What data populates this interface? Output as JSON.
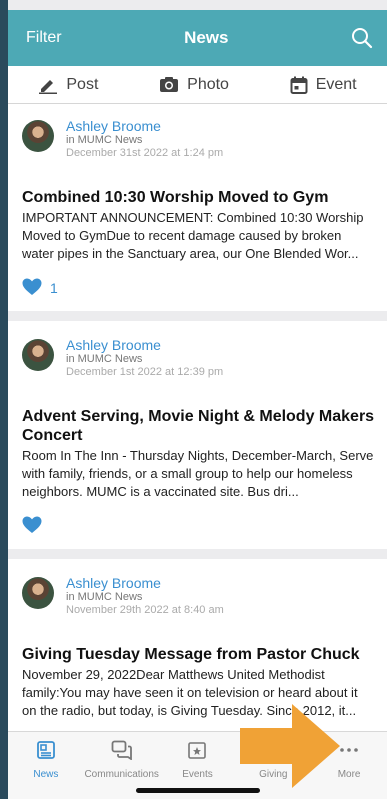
{
  "header": {
    "filter_label": "Filter",
    "title": "News",
    "search_icon": "search-icon"
  },
  "actions": [
    {
      "label": "Post",
      "icon": "pencil-icon"
    },
    {
      "label": "Photo",
      "icon": "camera-icon"
    },
    {
      "label": "Event",
      "icon": "calendar-icon"
    }
  ],
  "posts": [
    {
      "author": "Ashley Broome",
      "group": "in MUMC News",
      "date": "December 31st 2022 at 1:24 pm",
      "title": "Combined 10:30 Worship Moved to Gym",
      "body": "IMPORTANT ANNOUNCEMENT: Combined 10:30 Worship Moved to GymDue to recent damage caused by broken water pipes in the Sanctuary area, our One Blended Wor...",
      "likes": "1"
    },
    {
      "author": "Ashley Broome",
      "group": "in MUMC News",
      "date": "December 1st 2022 at 12:39 pm",
      "title": "Advent Serving, Movie Night & Melody Makers Concert",
      "body": "Room In The Inn - Thursday Nights, December-March, Serve with family, friends, or a small group to help our homeless neighbors. MUMC is a vaccinated site. Bus dri...",
      "likes": ""
    },
    {
      "author": "Ashley Broome",
      "group": "in MUMC News",
      "date": "November 29th 2022 at 8:40 am",
      "title": "Giving Tuesday Message from Pastor Chuck",
      "body": "November 29, 2022Dear Matthews United Methodist family:You may have seen it on television or heard about it on the radio, but today, is Giving Tuesday. Since 2012, it...",
      "likes": ""
    }
  ],
  "tabs": [
    {
      "label": "News",
      "icon": "news-icon",
      "active": true
    },
    {
      "label": "Communications",
      "icon": "chat-icon",
      "active": false
    },
    {
      "label": "Events",
      "icon": "calendar-star-icon",
      "active": false
    },
    {
      "label": "Giving",
      "icon": "giving-icon",
      "active": false
    },
    {
      "label": "More",
      "icon": "more-dots-icon",
      "active": false
    }
  ],
  "colors": {
    "header": "#4da9b5",
    "accent": "#3a8fd0",
    "arrow": "#f0a236"
  }
}
